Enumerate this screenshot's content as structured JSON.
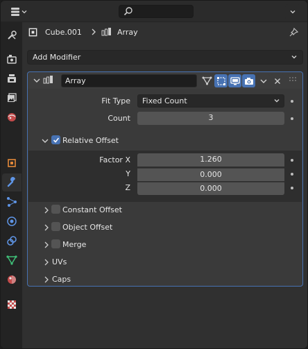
{
  "breadcrumb": {
    "object_name": "Cube.001",
    "modifier_name": "Array"
  },
  "add_modifier": {
    "label": "Add Modifier"
  },
  "modifier": {
    "name": "Array",
    "fit_type": {
      "label": "Fit Type",
      "value": "Fixed Count"
    },
    "count": {
      "label": "Count",
      "value": "3"
    },
    "relative_offset": {
      "label": "Relative Offset",
      "enabled": true,
      "factor_x": {
        "label": "Factor X",
        "value": "1.260"
      },
      "y": {
        "label": "Y",
        "value": "0.000"
      },
      "z": {
        "label": "Z",
        "value": "0.000"
      }
    },
    "constant_offset": {
      "label": "Constant Offset",
      "enabled": false
    },
    "object_offset": {
      "label": "Object Offset",
      "enabled": false
    },
    "merge": {
      "label": "Merge",
      "enabled": false
    },
    "uvs": {
      "label": "UVs"
    },
    "caps": {
      "label": "Caps"
    }
  },
  "sidebar_tabs": [
    "tool",
    "render",
    "output",
    "view-layer",
    "scene",
    "object",
    "modifiers",
    "particles",
    "physics",
    "constraints",
    "object-data",
    "material",
    "texture"
  ],
  "colors": {
    "accent": "#4772b3",
    "active_tab": "#3e74d6"
  }
}
